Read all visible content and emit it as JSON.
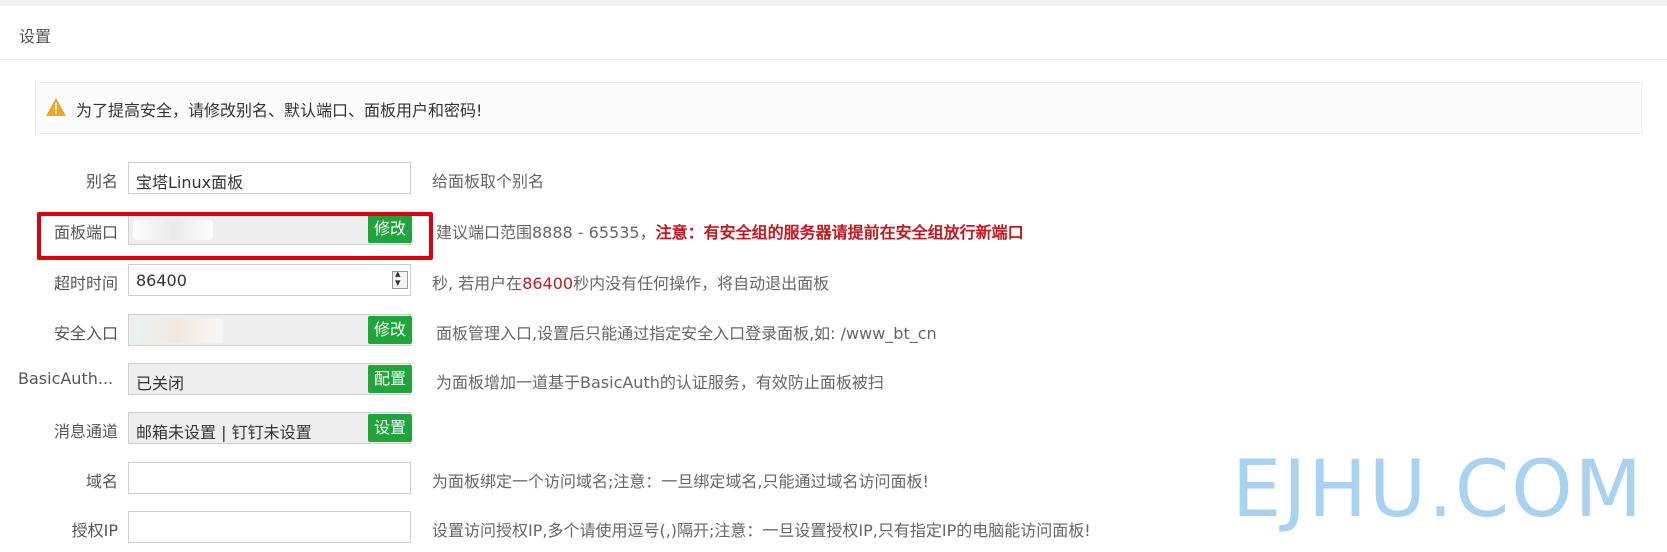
{
  "header": {
    "title": "设置"
  },
  "notice": {
    "icon": "warning-icon",
    "text": "为了提高安全，请修改别名、默认端口、面板用户和密码!"
  },
  "form": {
    "alias": {
      "label": "别名",
      "value": "宝塔Linux面板",
      "desc": "给面板取个别名"
    },
    "port": {
      "label": "面板端口",
      "value": "",
      "button": "修改",
      "desc": "建议端口范围8888 - 65535，",
      "desc_warn": "注意：有安全组的服务器请提前在安全组放行新端口"
    },
    "timeout": {
      "label": "超时时间",
      "value": "86400",
      "desc_pre": "秒, 若用户在",
      "desc_num": "86400",
      "desc_post": "秒内没有任何操作，将自动退出面板"
    },
    "entrance": {
      "label": "安全入口",
      "value": "",
      "button": "修改",
      "desc": "面板管理入口,设置后只能通过指定安全入口登录面板,如: /www_bt_cn"
    },
    "basicauth": {
      "label": "BasicAuth...",
      "value": "已关闭",
      "button": "配置",
      "desc": "为面板增加一道基于BasicAuth的认证服务，有效防止面板被扫"
    },
    "message": {
      "label": "消息通道",
      "value": "邮箱未设置 | 钉钉未设置",
      "button": "设置"
    },
    "domain": {
      "label": "域名",
      "value": "",
      "desc": "为面板绑定一个访问域名;注意：一旦绑定域名,只能通过域名访问面板!"
    },
    "authip": {
      "label": "授权IP",
      "value": "",
      "desc": "设置访问授权IP,多个请使用逗号(,)隔开;注意：一旦设置授权IP,只有指定IP的电脑能访问面板!"
    }
  },
  "watermark": "EJHU.COM",
  "colors": {
    "accent": "#20a53a",
    "warn": "#c7161c",
    "highlight": "#e0000a",
    "watermark": "#a9d2f1"
  }
}
